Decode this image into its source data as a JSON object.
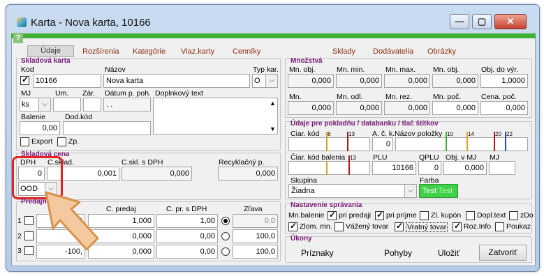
{
  "window": {
    "title": "Karta - Nova karta, 10166",
    "help": "?"
  },
  "tabs": [
    "Údaje",
    "Rozšírenia",
    "Kategórie",
    "Viaz.karty",
    "Cenníky",
    "Sklady",
    "Dodávatelia",
    "Obrázky"
  ],
  "skladova_karta": {
    "title": "Skladová karta",
    "kod_label": "Kod",
    "kod": "10166",
    "nazov_label": "Názov",
    "nazov": "Nova karta",
    "typ_label": "Typ kar.",
    "typ": "O",
    "mj_label": "MJ",
    "mj": "ks",
    "um_label": "Um.",
    "zar_label": "Zár.",
    "datum_label": "Dátum p. poh.",
    "datum": ". .",
    "doplnkovy_label": "Doplnkový text",
    "balenie_label": "Balenie",
    "balenie": "0,00",
    "dodkod_label": "Dod.kód",
    "export_label": "Export",
    "zp_label": "Zp."
  },
  "skladova_cena": {
    "title": "Skladová cena",
    "dph_label": "DPH",
    "dph": "0",
    "cskl_label": "C.sklad.",
    "cskl": "0,001",
    "csdph_label": "C.skl. s DPH",
    "csdph": "0,000",
    "recyk_label": "Recyklačný p.",
    "recyk": "0,000",
    "ood": "OOD"
  },
  "predajne": {
    "title": "Predajné ceny",
    "col_cp": "C. predaj",
    "col_cpdph": "C. pr. s DPH",
    "col_zlava": "Zľava",
    "rows": [
      {
        "n": "1",
        "a": "0,0",
        "cp": "1,000",
        "cpd": "1,00",
        "z": "0,0"
      },
      {
        "n": "2",
        "a": "-1",
        "cp": "0,000",
        "cpd": "0,00",
        "z": "100,0"
      },
      {
        "n": "3",
        "a": "-100,",
        "cp": "0,000",
        "cpd": "0,00",
        "z": "100,0"
      }
    ]
  },
  "mnozstva": {
    "title": "Množstvá",
    "r1_labels": [
      "Mn. obj.",
      "Mn. min.",
      "Mn. max.",
      "Mn. obj.",
      "Obj. do výr."
    ],
    "r1_values": [
      "0,000",
      "0,000",
      "0,000",
      "0,000",
      "1,0000"
    ],
    "r2_labels": [
      "Mn.",
      "Mn. odl.",
      "Mn. rez.",
      "Mn. poč.",
      "Cena. poč."
    ],
    "r2_values": [
      "0,000",
      "0,000",
      "0,000",
      "0,000",
      "0,000"
    ]
  },
  "pokladna": {
    "title": "Údaje pre pokladňu / databanku / tlač štítkov",
    "ciar_label": "Ciar. kód",
    "ack_label": "A. č. k.",
    "ack": "0",
    "nazov_pol_label": "Názov položky",
    "ticks_a": [
      "8",
      "13"
    ],
    "ticks_b": [
      "10",
      "14",
      "20",
      "22"
    ],
    "ciar_bal_label": "Čiar. kód balenia",
    "ticks_c": [
      "13"
    ],
    "plu_label": "PLU",
    "plu": "10166",
    "qplu_label": "QPLU",
    "qplu": "0",
    "objmj_label": "Obj. v MJ",
    "objmj": "0,000",
    "mj_label": "MJ",
    "skupina_label": "Skupina",
    "skupina": "Žiadna",
    "farba_label": "Farba",
    "farba_a": "Test",
    "farba_b": "Test"
  },
  "nastavenie": {
    "title": "Nastavenie správania",
    "mnbalenie": "Mn.balenie",
    "items_r1": [
      {
        "l": "pri predaji",
        "c": true
      },
      {
        "l": "pri príjme",
        "c": true
      },
      {
        "l": "Zl. kupón",
        "c": false
      },
      {
        "l": "Dopl.text",
        "c": false
      },
      {
        "l": "zDo",
        "c": false
      }
    ],
    "items_r2": [
      {
        "l": "Zlom. mn.",
        "c": true
      },
      {
        "l": "Vážený tovar",
        "c": false
      },
      {
        "l": "Vratný tovar",
        "c": true
      },
      {
        "l": "Roz.Info",
        "c": true
      },
      {
        "l": "Poukaz",
        "c": false
      }
    ]
  },
  "ukony": {
    "title": "Úkony",
    "priznaky": "Príznaky",
    "pohyby": "Pohyby",
    "ulozit": "Uložiť",
    "zatvorit": "Zatvoriť"
  },
  "colors": {
    "green": "#41ae35",
    "highlight": "#e32222",
    "title_purple": "#7a1a79"
  }
}
